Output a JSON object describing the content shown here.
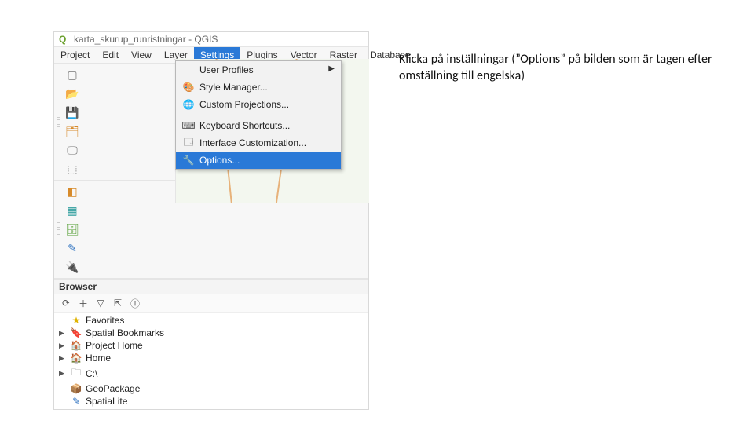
{
  "window": {
    "title": "karta_skurup_runristningar - QGIS"
  },
  "menubar": {
    "items": [
      "Project",
      "Edit",
      "View",
      "Layer",
      "Settings",
      "Plugins",
      "Vector",
      "Raster",
      "Database"
    ],
    "active_index": 4
  },
  "settings_menu": {
    "items": [
      {
        "label": "User Profiles",
        "icon": "",
        "has_submenu": true
      },
      {
        "label": "Style Manager...",
        "icon": "🎨"
      },
      {
        "label": "Custom Projections...",
        "icon": "🌐"
      },
      {
        "sep": true
      },
      {
        "label": "Keyboard Shortcuts...",
        "icon": "⌨"
      },
      {
        "label": "Interface Customization...",
        "icon": "🗔"
      },
      {
        "label": "Options...",
        "icon": "🔧",
        "highlight": true
      }
    ]
  },
  "toolbar1": {
    "buttons": [
      {
        "name": "new-project-icon",
        "glyph": "▢",
        "cls": "c-gray"
      },
      {
        "name": "open-project-icon",
        "glyph": "📂",
        "cls": "c-orange"
      },
      {
        "name": "save-project-icon",
        "glyph": "💾",
        "cls": "c-blue"
      },
      {
        "name": "layout-manager-icon",
        "glyph": "🗂",
        "cls": "c-orange"
      },
      {
        "name": "print-layout-icon",
        "glyph": "🖵",
        "cls": "c-gray"
      },
      {
        "name": "layout-icon",
        "glyph": "⬚",
        "cls": "c-gray"
      }
    ]
  },
  "toolbar2": {
    "buttons": [
      {
        "name": "add-vector-icon",
        "glyph": "◧",
        "cls": "c-orange"
      },
      {
        "name": "add-raster-icon",
        "glyph": "▦",
        "cls": "c-teal"
      },
      {
        "name": "add-db-icon",
        "glyph": "🗄",
        "cls": "c-green"
      },
      {
        "name": "pen-icon",
        "glyph": "✎",
        "cls": "c-blue"
      },
      {
        "name": "plugin-icon",
        "glyph": "🔌",
        "cls": "c-purple"
      }
    ]
  },
  "browser": {
    "title": "Browser",
    "tools": [
      {
        "name": "refresh-icon",
        "glyph": "⟳"
      },
      {
        "name": "add-icon",
        "glyph": "＋"
      },
      {
        "name": "filter-icon",
        "glyph": "▽"
      },
      {
        "name": "collapse-icon",
        "glyph": "⇱"
      },
      {
        "name": "info-icon",
        "glyph": "ⓘ"
      }
    ],
    "tree": [
      {
        "expand": "",
        "icon": "★",
        "icon_cls": "c-yellow",
        "label": "Favorites"
      },
      {
        "expand": "▶",
        "icon": "🔖",
        "icon_cls": "c-blue",
        "label": "Spatial Bookmarks"
      },
      {
        "expand": "▶",
        "icon": "🏠",
        "icon_cls": "c-green",
        "label": "Project Home"
      },
      {
        "expand": "▶",
        "icon": "🏠",
        "icon_cls": "c-gray",
        "label": "Home"
      },
      {
        "expand": "▶",
        "icon": "🗀",
        "icon_cls": "c-gray",
        "label": "C:\\"
      },
      {
        "expand": "",
        "icon": "📦",
        "icon_cls": "c-orange",
        "label": "GeoPackage"
      },
      {
        "expand": "",
        "icon": "✎",
        "icon_cls": "c-blue",
        "label": "SpatiaLite"
      }
    ]
  },
  "caption": {
    "text": "Klicka på inställningar (”Options” på bilden som är tagen efter omställning till engelska)"
  }
}
